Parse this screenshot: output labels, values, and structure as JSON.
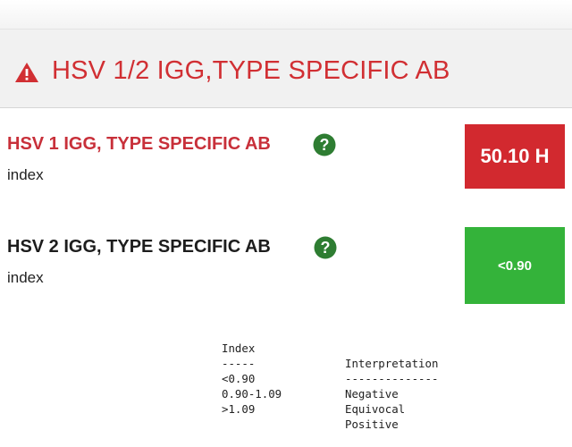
{
  "header": {
    "title": "HSV 1/2 IGG,TYPE SPECIFIC AB",
    "icon": "warning-triangle-icon",
    "color": "#d12f33"
  },
  "results": [
    {
      "name": "HSV 1 IGG, TYPE SPECIFIC AB",
      "unit": "index",
      "value": "50.10 H",
      "status": "high",
      "status_color": "#d2292f",
      "help_icon": "question-circle-icon"
    },
    {
      "name": "HSV 2 IGG, TYPE SPECIFIC AB",
      "unit": "index",
      "value": "<0.90",
      "status": "normal",
      "status_color": "#34b33a",
      "help_icon": "question-circle-icon"
    }
  ],
  "reference_table": {
    "headers": [
      "Index",
      "Interpretation"
    ],
    "separators": [
      "-----",
      "--------------"
    ],
    "rows": [
      [
        "<0.90",
        "Negative"
      ],
      [
        "0.90-1.09",
        "Equivocal"
      ],
      [
        ">1.09",
        "Positive"
      ]
    ]
  }
}
